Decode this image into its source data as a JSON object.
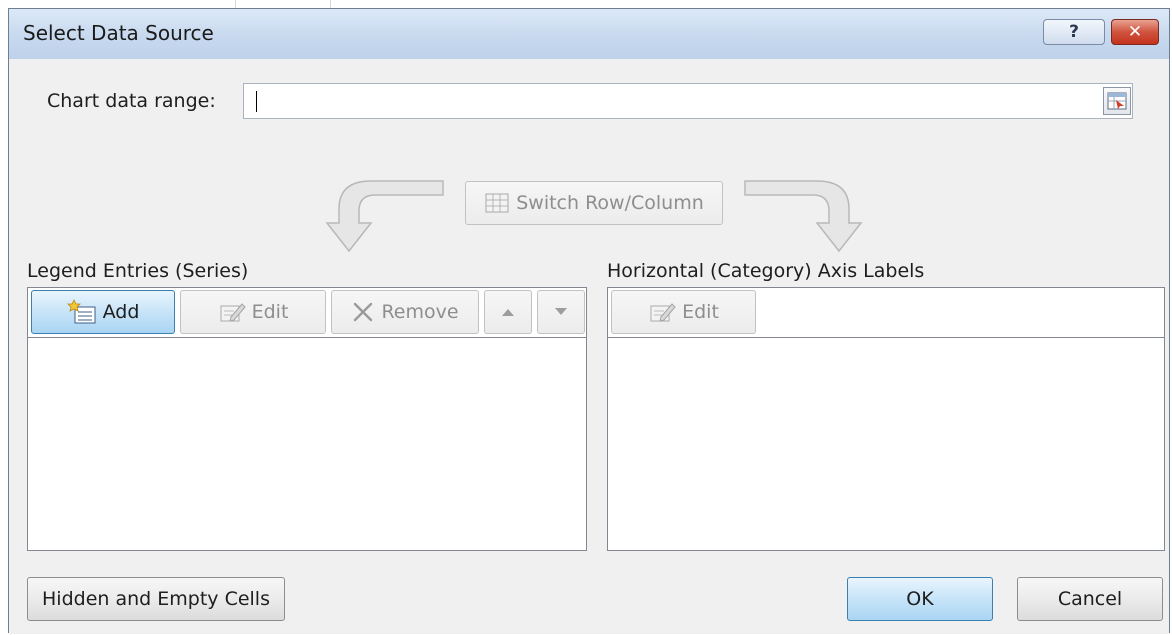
{
  "dialog": {
    "title": "Select Data Source",
    "help_label": "?",
    "close_label": "✕"
  },
  "range": {
    "label": "Chart data range:",
    "value": ""
  },
  "switch_button": {
    "label": "Switch Row/Column",
    "enabled": false
  },
  "legend": {
    "heading": "Legend Entries (Series)",
    "buttons": {
      "add": "Add",
      "edit": "Edit",
      "remove": "Remove"
    },
    "items": []
  },
  "axis": {
    "heading": "Horizontal (Category) Axis Labels",
    "buttons": {
      "edit": "Edit"
    },
    "items": []
  },
  "footer": {
    "hidden_cells": "Hidden and Empty Cells",
    "ok": "OK",
    "cancel": "Cancel"
  },
  "colors": {
    "title_gradient_top": "#dde9f7",
    "close_red": "#c4331e",
    "primary_blue": "#a9d5f3",
    "disabled_text": "#8e8e8e"
  }
}
